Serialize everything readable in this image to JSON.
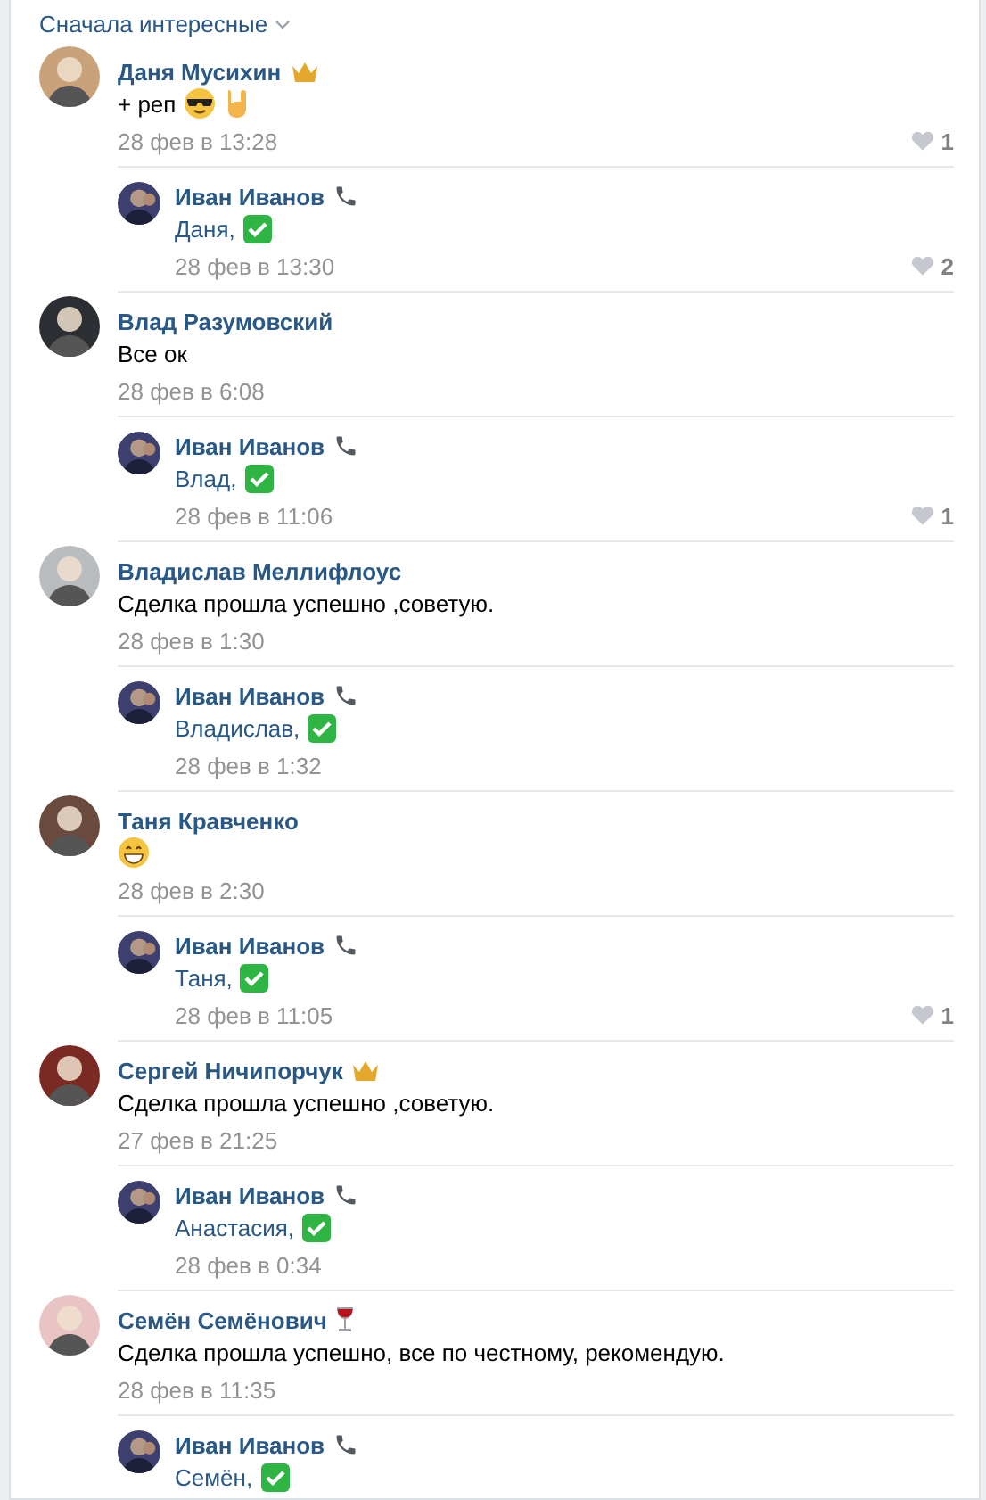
{
  "sort": {
    "label": "Сначала интересные"
  },
  "threads": [
    {
      "comment": {
        "author": "Даня Мусихин",
        "badge": {
          "kind": "crown"
        },
        "text": "+ реп",
        "emojis": [
          {
            "kind": "sunglasses"
          },
          {
            "kind": "horns"
          }
        ],
        "date": "28 фев в 13:28",
        "likes": "1"
      },
      "reply": {
        "author": "Иван Иванов",
        "badge": {
          "kind": "phone"
        },
        "text": "Даня,",
        "emojis": [
          {
            "kind": "check"
          }
        ],
        "date": "28 фев в 13:30",
        "likes": "2"
      }
    },
    {
      "comment": {
        "author": "Влад Разумовский",
        "text": "Все ок",
        "date": "28 фев в 6:08"
      },
      "reply": {
        "author": "Иван Иванов",
        "badge": {
          "kind": "phone"
        },
        "text": "Влад,",
        "emojis": [
          {
            "kind": "check"
          }
        ],
        "date": "28 фев в 11:06",
        "likes": "1"
      }
    },
    {
      "comment": {
        "author": "Владислав Меллифлоус",
        "text": "Сделка прошла успешно ,советую.",
        "date": "28 фев в 1:30"
      },
      "reply": {
        "author": "Иван Иванов",
        "badge": {
          "kind": "phone"
        },
        "text": "Владислав,",
        "emojis": [
          {
            "kind": "check"
          }
        ],
        "date": "28 фев в 1:32"
      }
    },
    {
      "comment": {
        "author": "Таня Кравченко",
        "emojis": [
          {
            "kind": "grin"
          }
        ],
        "date": "28 фев в 2:30"
      },
      "reply": {
        "author": "Иван Иванов",
        "badge": {
          "kind": "phone"
        },
        "text": "Таня,",
        "emojis": [
          {
            "kind": "check"
          }
        ],
        "date": "28 фев в 11:05",
        "likes": "1"
      }
    },
    {
      "comment": {
        "author": "Сергей Ничипорчук",
        "badge": {
          "kind": "crown"
        },
        "text": "Сделка прошла успешно ,советую.",
        "date": "27 фев в 21:25"
      },
      "reply": {
        "author": "Иван Иванов",
        "badge": {
          "kind": "phone"
        },
        "text": "Анастасия,",
        "emojis": [
          {
            "kind": "check"
          }
        ],
        "date": "28 фев в 0:34"
      }
    },
    {
      "comment": {
        "author": "Семён Семёнович",
        "badge": {
          "kind": "wine"
        },
        "text": "Сделка прошла успешно, все по честному, рекомендую.",
        "date": "28 фев в 11:35"
      },
      "reply": {
        "author": "Иван Иванов",
        "badge": {
          "kind": "phone"
        },
        "text": "Семён,",
        "emojis": [
          {
            "kind": "check"
          }
        ]
      }
    }
  ]
}
